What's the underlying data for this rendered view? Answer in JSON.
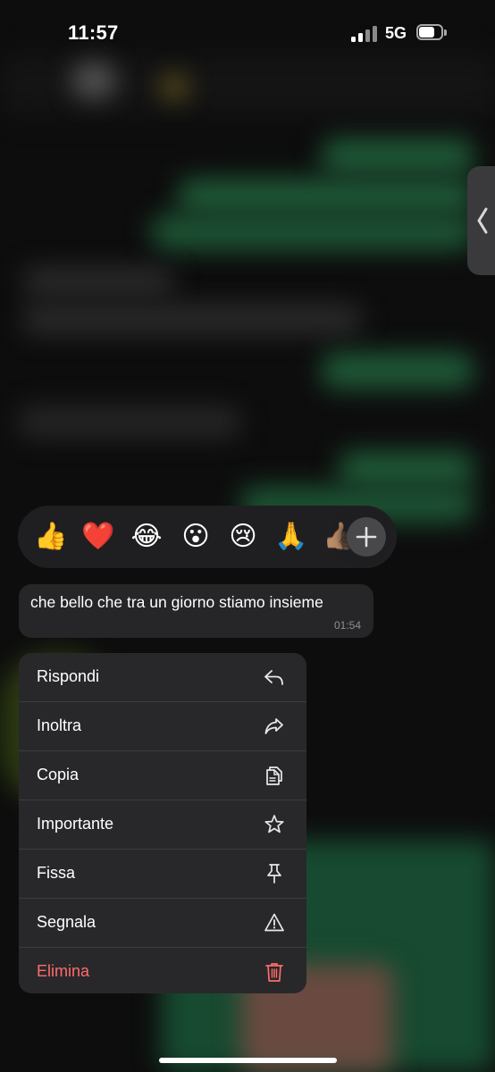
{
  "status_bar": {
    "time": "11:57",
    "network": "5G"
  },
  "reactions": {
    "emojis": [
      {
        "name": "thumbs-up",
        "glyph": "👍"
      },
      {
        "name": "red-heart",
        "glyph": "❤️"
      },
      {
        "name": "tears-of-joy",
        "glyph": "😂"
      },
      {
        "name": "astonished",
        "glyph": "😮"
      },
      {
        "name": "crying",
        "glyph": "😢"
      },
      {
        "name": "folded-hands",
        "glyph": "🙏"
      },
      {
        "name": "partial-emoji",
        "glyph": "👍🏽"
      }
    ],
    "more_icon": "plus-icon"
  },
  "message": {
    "text": "che bello che tra un giorno stiamo insieme",
    "time": "01:54"
  },
  "menu": {
    "items": [
      {
        "label": "Rispondi",
        "icon": "reply-icon"
      },
      {
        "label": "Inoltra",
        "icon": "forward-icon"
      },
      {
        "label": "Copia",
        "icon": "copy-icon"
      },
      {
        "label": "Importante",
        "icon": "star-icon"
      },
      {
        "label": "Fissa",
        "icon": "pin-icon"
      },
      {
        "label": "Segnala",
        "icon": "warning-icon"
      },
      {
        "label": "Elimina",
        "icon": "trash-icon"
      }
    ]
  },
  "colors": {
    "danger": "#ff6b6b",
    "menu_bg": "#28282a",
    "bubble_bg": "#262628"
  }
}
